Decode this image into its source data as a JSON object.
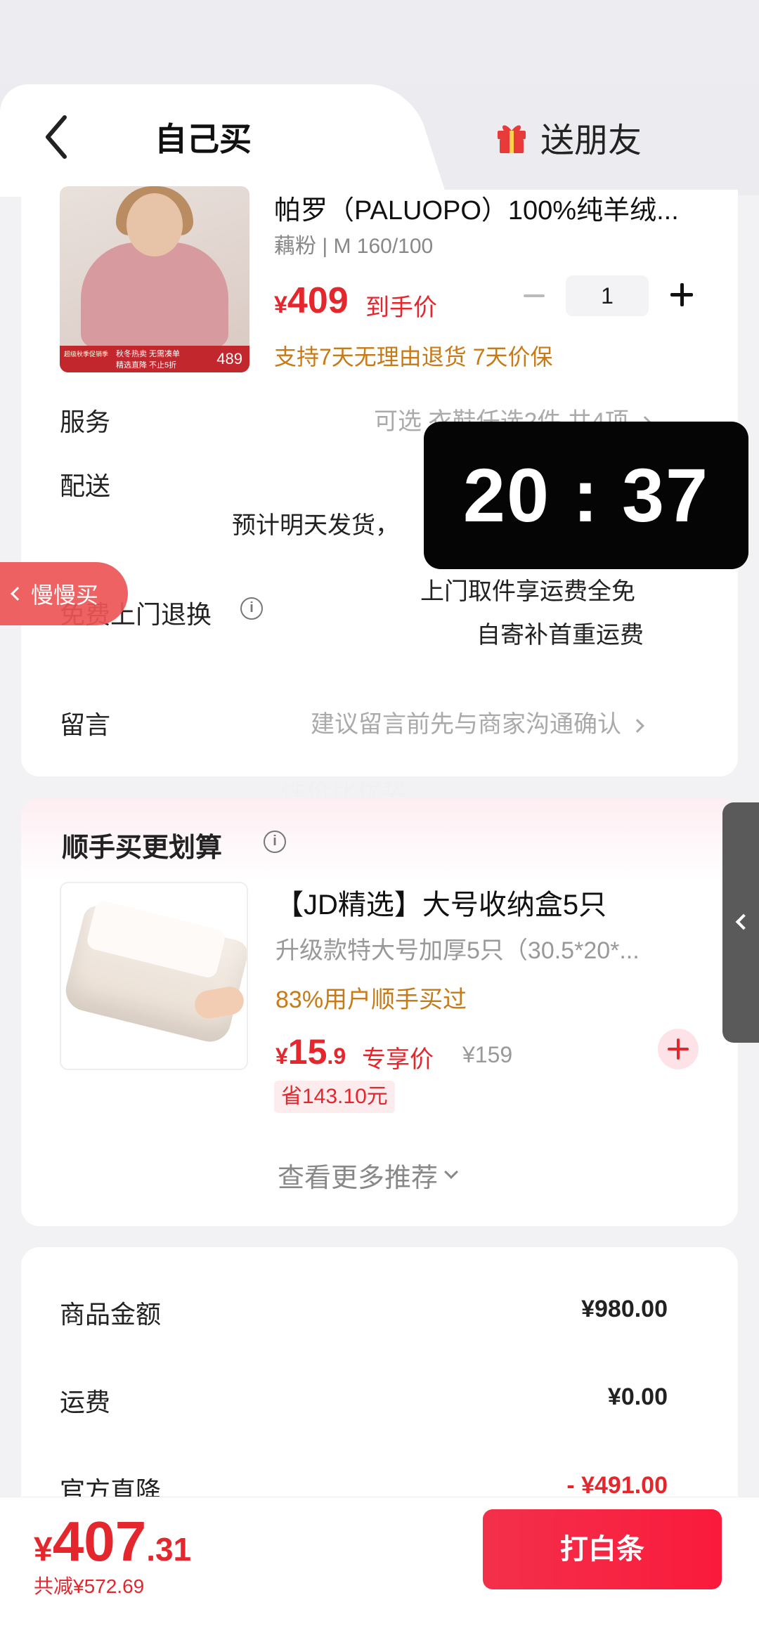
{
  "tabs": {
    "self_buy": "自己买",
    "send_friend": "送朋友"
  },
  "product": {
    "title": "帕罗（PALUOPO）100%纯羊绒...",
    "spec": "藕粉 | M 160/100",
    "price_currency": "¥",
    "price": "409",
    "price_label": "到手价",
    "quantity": "1",
    "promise": "支持7天无理由退货  7天价保",
    "image_banner": {
      "tag": "超级秋季促销季",
      "line1": "秋冬热卖 无需凑单",
      "line2": "精选直降 不止5折",
      "price": "489"
    }
  },
  "rows": {
    "service_label": "服务",
    "service_value": "可选 衣鞋任选2件 共4项",
    "delivery_label": "配送",
    "delivery_value": "预计明天发货，",
    "return_label": "免费上门退换",
    "return_line1": "上门取件享运费全免",
    "return_line2": "自寄补首重运费",
    "note_label": "留言",
    "note_value": "建议留言前先与商家沟通确认"
  },
  "timer": "20 : 37",
  "slow_buy": "慢慢买",
  "ghost": "性价比优势",
  "addon": {
    "section_title": "顺手买更划算",
    "title": "【JD精选】大号收纳盒5只",
    "subtitle": "升级款特大号加厚5只（30.5*20*...",
    "hot": "83%用户顺手买过",
    "price_currency": "¥",
    "price_int": "15",
    "price_dec": ".9",
    "price_label": "专享价",
    "original_price": "¥159",
    "save": "省143.10元",
    "more": "查看更多推荐"
  },
  "summary": {
    "goods_label": "商品金额",
    "goods_value": "¥980.00",
    "shipping_label": "运费",
    "shipping_value": "¥0.00",
    "discount_label": "官方直降",
    "discount_value": "- ¥491.00"
  },
  "footer": {
    "total_currency": "¥",
    "total_int": "407",
    "total_dec": ".31",
    "reduced": "共减¥572.69",
    "pay_button": "打白条"
  },
  "colors": {
    "accent_red": "#e4262d",
    "promise_gold": "#c77a18"
  }
}
